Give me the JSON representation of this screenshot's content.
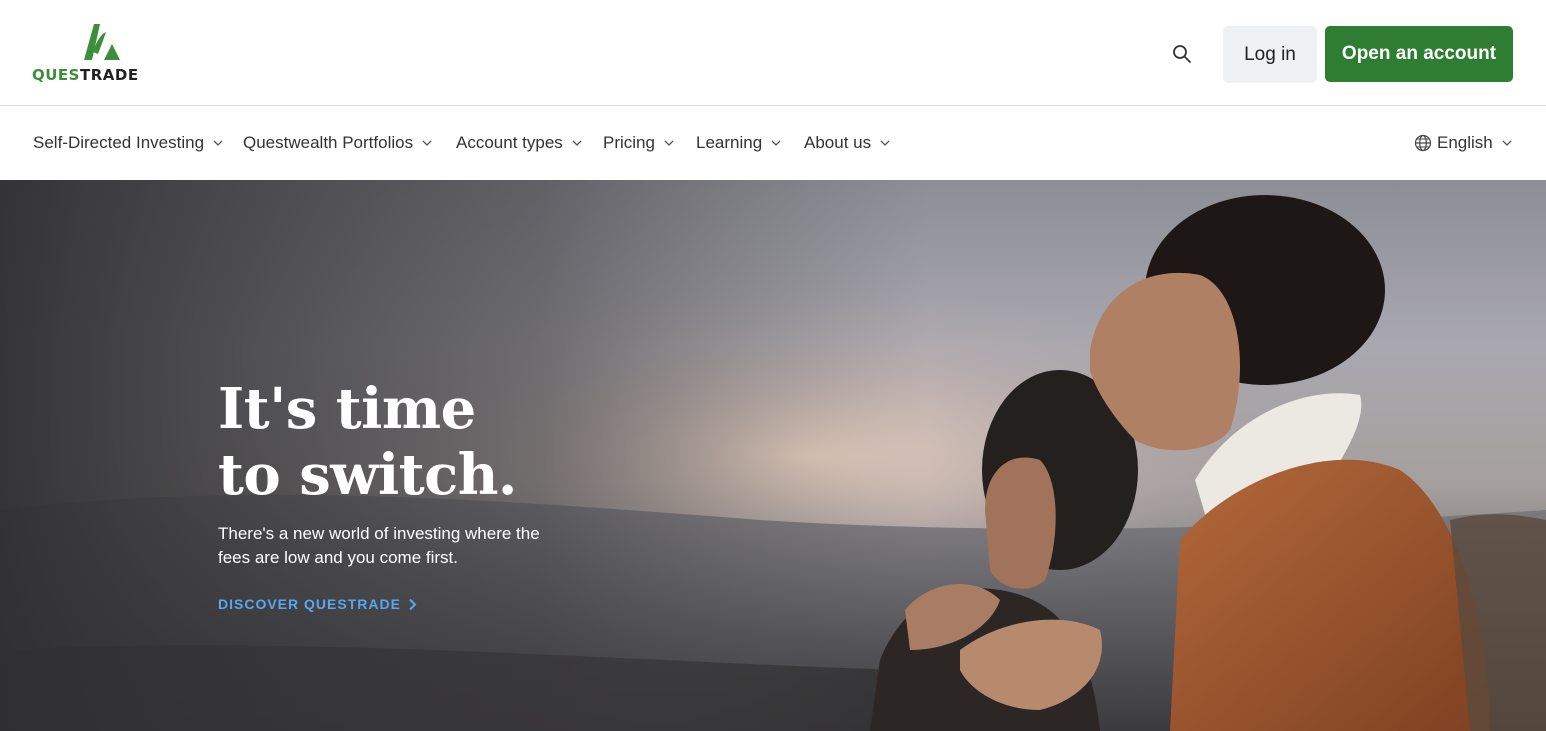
{
  "header": {
    "logo_text_left": "QUES",
    "logo_text_right": "TRADE",
    "login_label": "Log in",
    "open_account_label": "Open an account"
  },
  "nav": {
    "items": [
      {
        "label": "Self-Directed Investing"
      },
      {
        "label": "Questwealth Portfolios"
      },
      {
        "label": "Account types"
      },
      {
        "label": "Pricing"
      },
      {
        "label": "Learning"
      },
      {
        "label": "About us"
      }
    ],
    "language_label": "English"
  },
  "hero": {
    "title_line1": "It's time",
    "title_line2": "to switch.",
    "subtitle": "There's a new world of investing where the fees are low and you come first.",
    "cta_label": "DISCOVER QUESTRADE"
  },
  "colors": {
    "brand_green": "#2e7d32",
    "logo_green": "#3d8e3a",
    "cta_blue": "#5aa6ee"
  },
  "icons": [
    "questrade-logo-icon",
    "search-icon",
    "chevron-down-icon",
    "globe-icon",
    "chevron-right-icon"
  ]
}
